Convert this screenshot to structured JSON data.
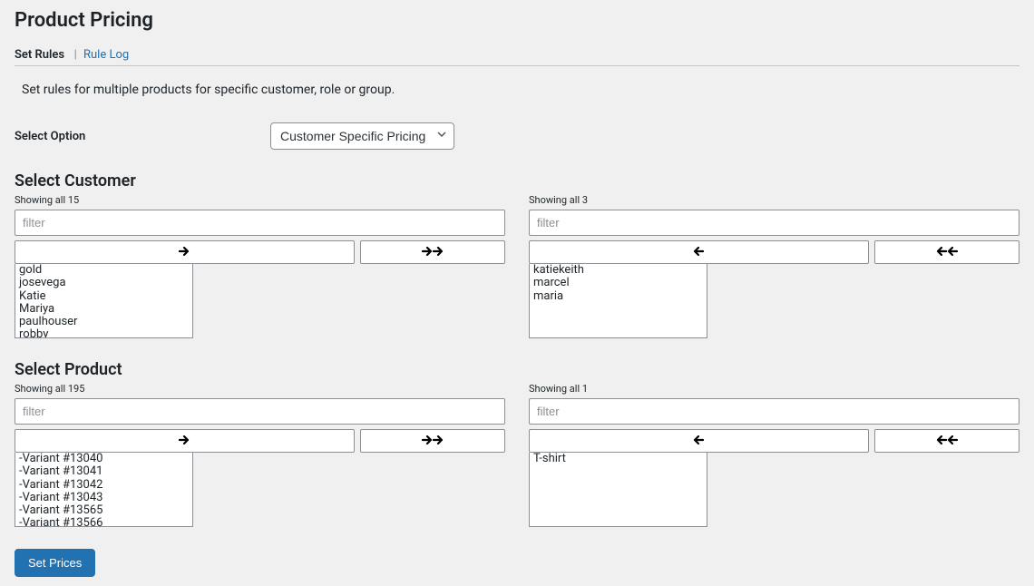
{
  "page_title": "Product Pricing",
  "tabs": {
    "set_rules": "Set Rules",
    "rule_log": "Rule Log"
  },
  "description": "Set rules for multiple products for specific customer, role or group.",
  "option": {
    "label": "Select Option",
    "selected": "Customer Specific Pricing"
  },
  "customer": {
    "title": "Select Customer",
    "left_counter": "Showing all 15",
    "right_counter": "Showing all 3",
    "filter_placeholder": "filter",
    "left_items": [
      "gold",
      "josevega",
      "Katie",
      "Mariya",
      "paulhouser",
      "robby"
    ],
    "right_items": [
      "katiekeith",
      "marcel",
      "maria"
    ]
  },
  "product": {
    "title": "Select Product",
    "left_counter": "Showing all 195",
    "right_counter": "Showing all 1",
    "filter_placeholder": "filter",
    "left_items": [
      "-Variant #13040",
      "-Variant #13041",
      "-Variant #13042",
      "-Variant #13043",
      "-Variant #13565",
      "-Variant #13566"
    ],
    "right_items": [
      "T-shirt"
    ]
  },
  "button_label": "Set Prices"
}
